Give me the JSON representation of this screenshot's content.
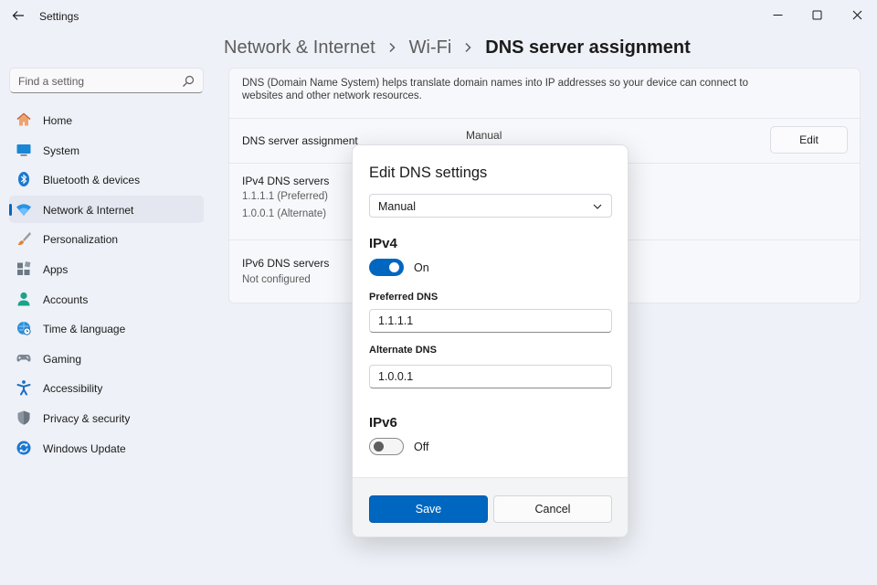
{
  "window": {
    "title": "Settings",
    "controls": [
      "minimize-icon",
      "maximize-icon",
      "close-icon"
    ]
  },
  "breadcrumb": {
    "items": [
      "Network & Internet",
      "Wi-Fi"
    ],
    "current": "DNS server assignment"
  },
  "search": {
    "placeholder": "Find a setting",
    "value": ""
  },
  "sidebar": {
    "active": "Network & Internet",
    "items": [
      {
        "label": "Home",
        "icon": "home-icon"
      },
      {
        "label": "System",
        "icon": "system-monitor-icon"
      },
      {
        "label": "Bluetooth & devices",
        "icon": "bluetooth-icon"
      },
      {
        "label": "Network & Internet",
        "icon": "wifi-icon"
      },
      {
        "label": "Personalization",
        "icon": "paintbrush-icon"
      },
      {
        "label": "Apps",
        "icon": "apps-icon"
      },
      {
        "label": "Accounts",
        "icon": "accounts-icon"
      },
      {
        "label": "Time & language",
        "icon": "globe-clock-icon"
      },
      {
        "label": "Gaming",
        "icon": "gamepad-icon"
      },
      {
        "label": "Accessibility",
        "icon": "accessibility-icon"
      },
      {
        "label": "Privacy & security",
        "icon": "shield-icon"
      },
      {
        "label": "Windows Update",
        "icon": "update-icon"
      }
    ]
  },
  "main": {
    "description": "DNS (Domain Name System) helps translate domain names into IP addresses so your device can connect to websites and other network resources.",
    "assignment": {
      "label": "DNS server assignment",
      "value": "Manual",
      "edit_label": "Edit"
    },
    "ipv4": {
      "label": "IPv4 DNS servers",
      "preferred": "1.1.1.1 (Preferred)",
      "alternate": "1.0.0.1 (Alternate)"
    },
    "ipv6": {
      "label": "IPv6 DNS servers",
      "status": "Not configured"
    }
  },
  "dialog": {
    "title": "Edit DNS settings",
    "mode": "Manual",
    "ipv4": {
      "heading": "IPv4",
      "toggle_on": true,
      "toggle_label": "On",
      "preferred_label": "Preferred DNS",
      "preferred_value": "1.1.1.1",
      "alternate_label": "Alternate DNS",
      "alternate_value": "1.0.0.1"
    },
    "ipv6": {
      "heading": "IPv6",
      "toggle_on": false,
      "toggle_label": "Off"
    },
    "save_label": "Save",
    "cancel_label": "Cancel"
  },
  "colors": {
    "accent": "#0067c0",
    "background": "#eef1f7"
  }
}
